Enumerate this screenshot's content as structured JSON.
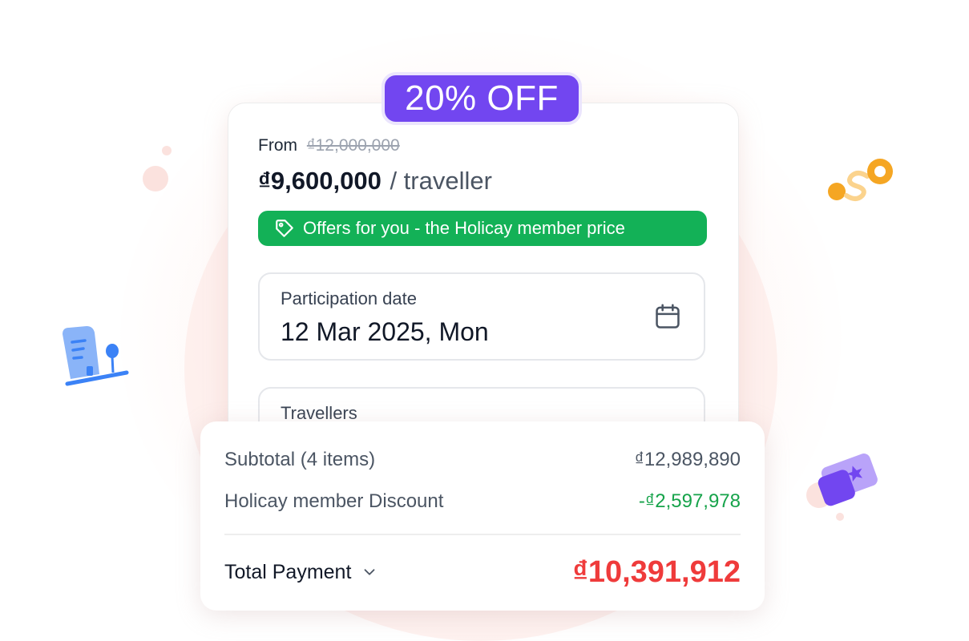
{
  "badge": {
    "text": "20% OFF"
  },
  "price": {
    "from_label": "From",
    "original": "₫12,000,000",
    "current": "₫9,600,000",
    "per_unit": "/ traveller"
  },
  "offer": {
    "text": "Offers for you - the Holicay member price",
    "icon": "tag-icon"
  },
  "date_field": {
    "label": "Participation date",
    "value": "12 Mar 2025, Mon",
    "icon": "calendar-icon"
  },
  "travellers_field": {
    "label": "Travellers"
  },
  "summary": {
    "subtotal_label": "Subtotal (4 items)",
    "subtotal_value": "₫12,989,890",
    "discount_label": "Holicay member Discount",
    "discount_value": "-₫2,597,978",
    "total_label": "Total Payment",
    "total_value": "₫10,391,912"
  },
  "colors": {
    "badge_bg": "#7246f0",
    "offer_bg": "#13b157",
    "discount": "#16a34a",
    "total": "#ef3b3b"
  }
}
